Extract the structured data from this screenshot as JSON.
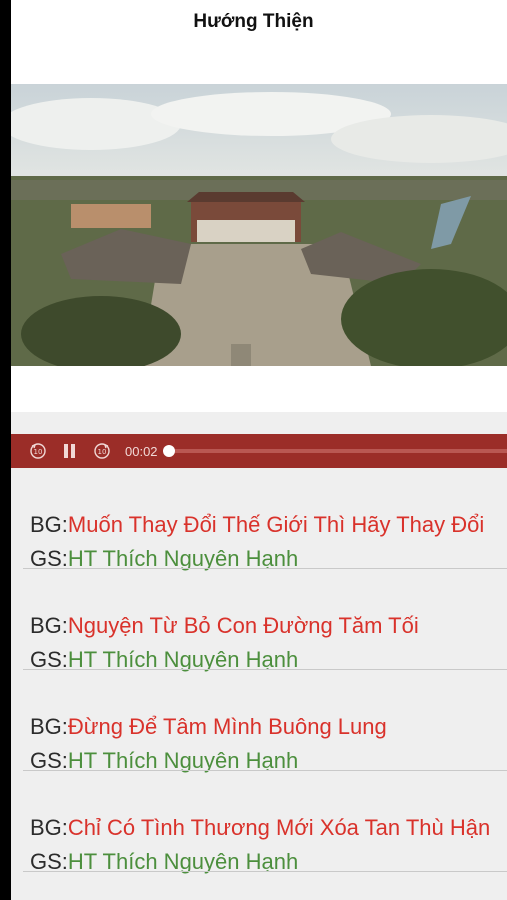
{
  "header": {
    "title": "Hướng Thiện"
  },
  "player": {
    "rewind_icon": "rewind-10-icon",
    "pause_icon": "pause-icon",
    "forward_icon": "forward-10-icon",
    "elapsed": "00:02",
    "progress": 0.0
  },
  "colors": {
    "player_bg": "#9b2d28",
    "title": "#d9322b",
    "author": "#4c8f3d"
  },
  "lectures": [
    {
      "title_prefix": "BG:",
      "title": "Muốn Thay Đổi Thế Giới Thì Hãy Thay Đổi",
      "author_prefix": "GS:",
      "author": "HT Thích Nguyên Hạnh"
    },
    {
      "title_prefix": "BG:",
      "title": "Nguyện Từ Bỏ Con Đường Tăm Tối",
      "author_prefix": "GS:",
      "author": "HT Thích Nguyên Hạnh"
    },
    {
      "title_prefix": "BG:",
      "title": "Đừng Để Tâm Mình Buông Lung",
      "author_prefix": "GS:",
      "author": "HT Thích Nguyên Hạnh"
    },
    {
      "title_prefix": "BG:",
      "title": "Chỉ Có Tình Thương Mới Xóa Tan Thù Hận",
      "author_prefix": "GS:",
      "author": "HT Thích Nguyên Hạnh"
    }
  ]
}
